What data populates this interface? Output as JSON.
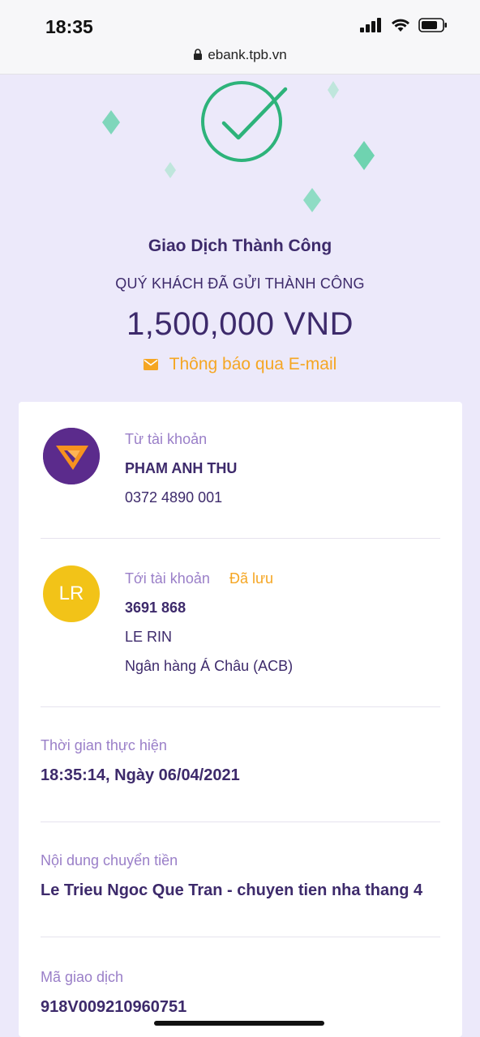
{
  "status_bar": {
    "time": "18:35",
    "url": "ebank.tpb.vn",
    "icons": [
      "signal-icon",
      "wifi-icon",
      "battery-icon",
      "lock-icon"
    ]
  },
  "result": {
    "title": "Giao Dịch Thành Công",
    "subtitle": "QUÝ KHÁCH ĐÃ GỬI THÀNH CÔNG",
    "amount": "1,500,000 VND",
    "email_notice": "Thông báo qua E-mail",
    "icon": "check-circle-icon"
  },
  "from_account": {
    "label": "Từ tài khoản",
    "name": "PHAM ANH THU",
    "number": "0372 4890 001"
  },
  "to_account": {
    "label": "Tới tài khoản",
    "saved": "Đã lưu",
    "avatar_initials": "LR",
    "number": "3691 868",
    "name": "LE RIN",
    "bank": "Ngân hàng Á Châu (ACB)"
  },
  "time_section": {
    "label": "Thời gian thực hiện",
    "value": "18:35:14, Ngày 06/04/2021"
  },
  "content_section": {
    "label": "Nội dung chuyển tiền",
    "value": "Le Trieu Ngoc Que Tran - chuyen tien nha thang 4"
  },
  "code_section": {
    "label": "Mã giao dịch",
    "value": "918V009210960751"
  },
  "colors": {
    "background": "#ece9fa",
    "primary_text": "#3d2a6b",
    "label": "#9a7fc8",
    "accent_orange": "#f5a623",
    "success_green": "#2db37a",
    "avatar_yellow": "#f2c318"
  }
}
